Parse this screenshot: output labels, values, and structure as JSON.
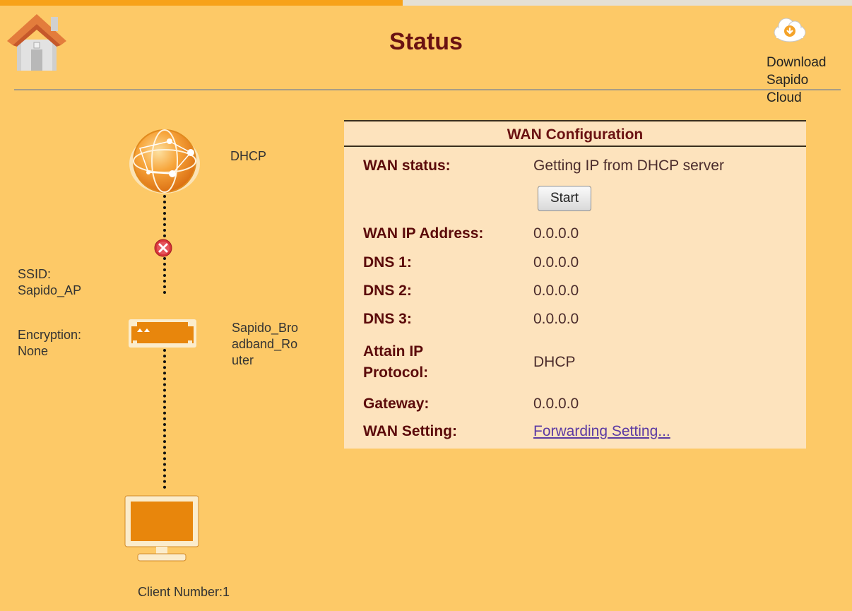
{
  "header": {
    "title": "Status",
    "cloud_link_label": "Download\nSapido\nCloud"
  },
  "topology": {
    "wan_mode": "DHCP",
    "router_name": "Sapido_Bro\nadband_Ro\nuter",
    "ssid": "SSID:\nSapido_AP",
    "encryption": "Encryption:\nNone",
    "client_number": "Client Number:1"
  },
  "wan": {
    "title": "WAN Configuration",
    "rows": [
      {
        "label": "WAN status:",
        "value": "Getting IP from DHCP server"
      },
      {
        "label": "WAN IP Address:",
        "value": "0.0.0.0"
      },
      {
        "label": "DNS 1:",
        "value": "0.0.0.0"
      },
      {
        "label": "DNS 2:",
        "value": "0.0.0.0"
      },
      {
        "label": "DNS 3:",
        "value": "0.0.0.0"
      },
      {
        "label": "Attain IP\nProtocol:",
        "value": "DHCP"
      },
      {
        "label": "Gateway:",
        "value": "0.0.0.0"
      },
      {
        "label": "WAN Setting:",
        "value": "Forwarding Setting..."
      }
    ],
    "start_button": "Start"
  },
  "colors": {
    "background": "#fdc967",
    "accent_orange": "#f29417",
    "title": "#6a1212",
    "panel": "#fde3bd"
  }
}
